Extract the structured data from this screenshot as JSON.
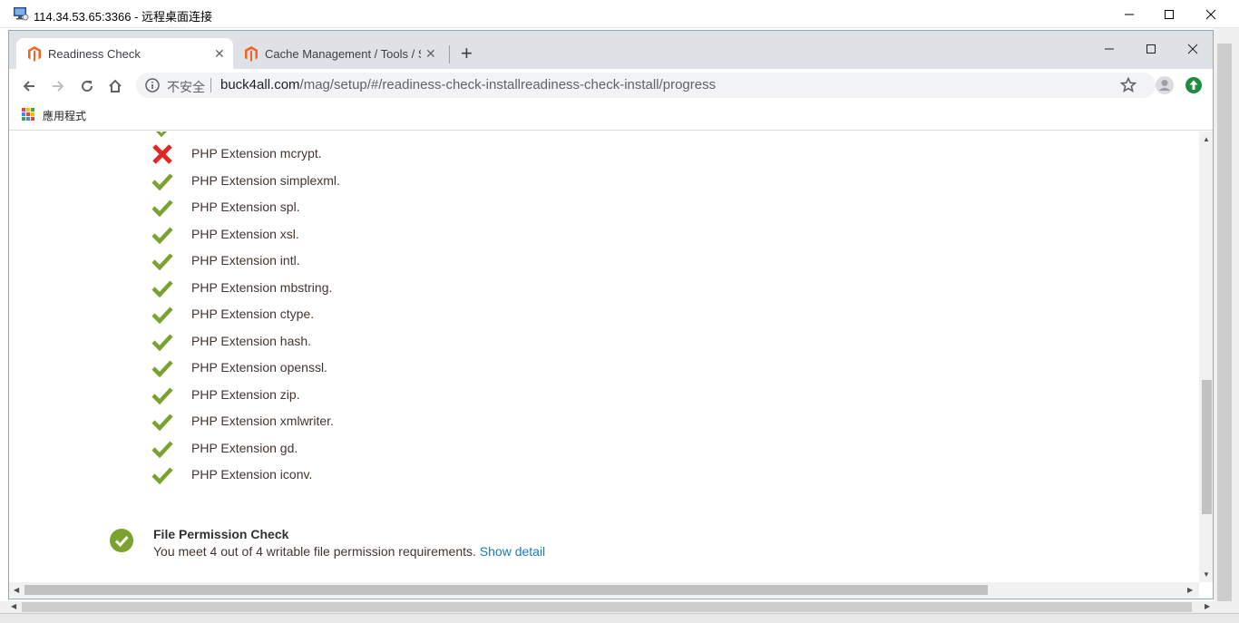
{
  "rdp": {
    "title": "114.34.53.65:3366 - 远程桌面连接"
  },
  "browser": {
    "tabs": [
      {
        "label": "Readiness Check",
        "active": true
      },
      {
        "label": "Cache Management / Tools / S",
        "active": false
      }
    ],
    "omnibox": {
      "security_label": "不安全",
      "url_host": "buck4all.com",
      "url_path": "/mag/setup/#/readiness-check-installreadiness-check-install/progress"
    },
    "bookmarks": {
      "apps_label": "應用程式"
    }
  },
  "page": {
    "extensions": [
      {
        "label": "PHP Extension mcrypt.",
        "status": "fail"
      },
      {
        "label": "PHP Extension simplexml.",
        "status": "pass"
      },
      {
        "label": "PHP Extension spl.",
        "status": "pass"
      },
      {
        "label": "PHP Extension xsl.",
        "status": "pass"
      },
      {
        "label": "PHP Extension intl.",
        "status": "pass"
      },
      {
        "label": "PHP Extension mbstring.",
        "status": "pass"
      },
      {
        "label": "PHP Extension ctype.",
        "status": "pass"
      },
      {
        "label": "PHP Extension hash.",
        "status": "pass"
      },
      {
        "label": "PHP Extension openssl.",
        "status": "pass"
      },
      {
        "label": "PHP Extension zip.",
        "status": "pass"
      },
      {
        "label": "PHP Extension xmlwriter.",
        "status": "pass"
      },
      {
        "label": "PHP Extension gd.",
        "status": "pass"
      },
      {
        "label": "PHP Extension iconv.",
        "status": "pass"
      }
    ],
    "file_permission": {
      "title": "File Permission Check",
      "description": "You meet 4 out of 4 writable file permission requirements.",
      "link": "Show detail"
    }
  },
  "colors": {
    "pass": "#79a22e",
    "fail": "#e22626",
    "link": "#1979c3",
    "magento": "#f26322"
  }
}
